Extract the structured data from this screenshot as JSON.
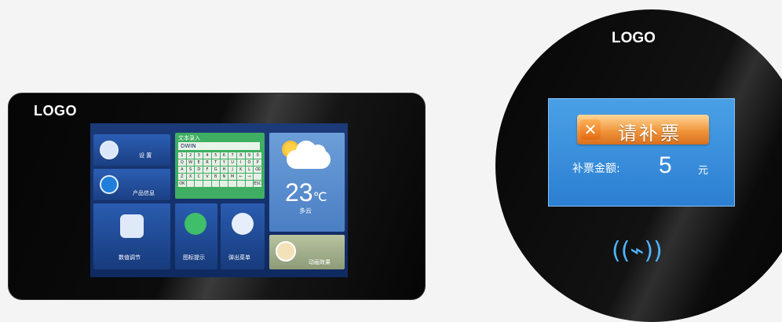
{
  "rect_device": {
    "logo": "LOGO",
    "screen": {
      "settings_label": "设 置",
      "product_info_label": "产品信息",
      "value_adjust_label": "数值调节",
      "icon_tip_label": "图标提示",
      "popup_menu_label": "弹出菜单",
      "animation_label": "动画效果",
      "keyboard": {
        "title": "文本录入",
        "input_value": "DWIN",
        "rows": [
          [
            "1",
            "2",
            "3",
            "4",
            "5",
            "6",
            "7",
            "8",
            "9",
            "0"
          ],
          [
            "Q",
            "W",
            "E",
            "R",
            "T",
            "Y",
            "U",
            "I",
            "O",
            "P"
          ],
          [
            "A",
            "S",
            "D",
            "F",
            "G",
            "H",
            "J",
            "K",
            "L",
            "⌫"
          ],
          [
            "Z",
            "X",
            "C",
            "V",
            "B",
            "N",
            "M",
            "←",
            "→",
            ""
          ],
          [
            "OK",
            "",
            "",
            "",
            "",
            "",
            "",
            "",
            "",
            "ESC"
          ]
        ]
      },
      "weather": {
        "temperature": "23",
        "unit": "℃",
        "condition": "多云"
      }
    }
  },
  "round_device": {
    "logo": "LOGO",
    "screen": {
      "title": "请补票",
      "amount_label": "补票金额:",
      "amount_value": "5",
      "amount_unit": "元"
    },
    "nfc_icon": "contactless-icon"
  },
  "colors": {
    "accent_blue": "#2c7fd2",
    "banner_orange": "#f0953a",
    "keyboard_green": "#3fae62",
    "nfc_blue": "#4fb4ff"
  }
}
